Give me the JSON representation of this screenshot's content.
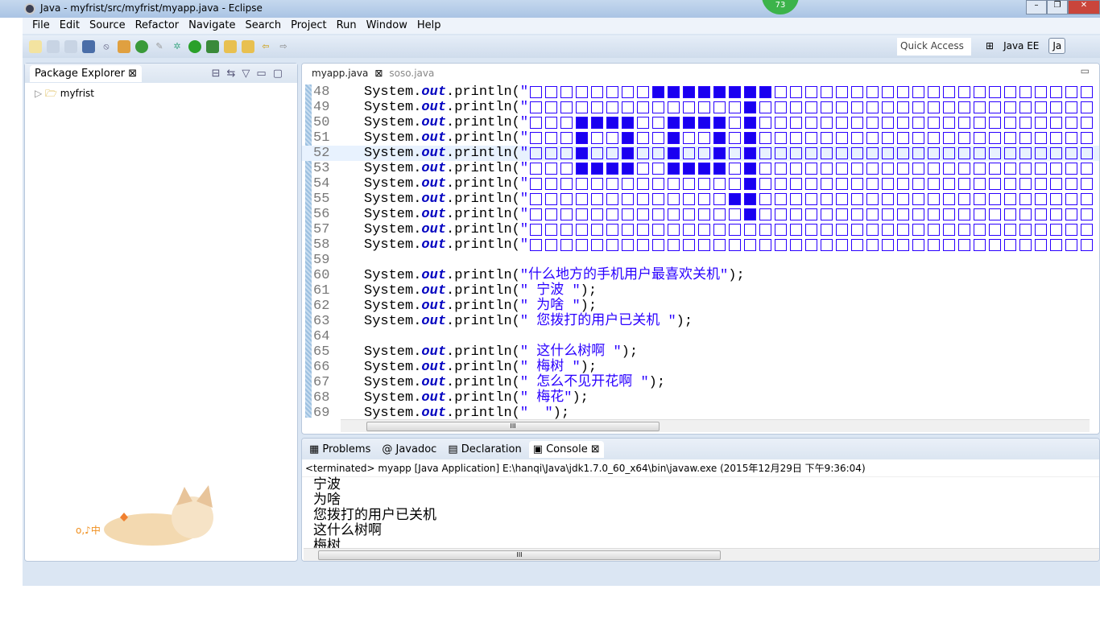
{
  "window": {
    "title": "Java - myfrist/src/myfrist/myapp.java - Eclipse",
    "badge": "73",
    "min": "–",
    "max": "❐",
    "close": "✕"
  },
  "menu": [
    "File",
    "Edit",
    "Source",
    "Refactor",
    "Navigate",
    "Search",
    "Project",
    "Run",
    "Window",
    "Help"
  ],
  "toolbar": {
    "quick_access": "Quick Access",
    "perspectives": [
      "Java EE",
      "Ja"
    ]
  },
  "package_explorer": {
    "title": "Package Explorer",
    "tree": [
      {
        "label": "myfrist",
        "expanded": false
      }
    ],
    "decoration_text": "o,♪中"
  },
  "editor": {
    "tabs": [
      {
        "label": "myapp.java",
        "active": true
      },
      {
        "label": "soso.java",
        "active": false
      }
    ],
    "current_line": 52,
    "lines": [
      {
        "n": "48",
        "type": "pattern",
        "pattern": "□□□□□□□□■■■■■■■■□□□□□□□□□□□□□□□□□□□□□"
      },
      {
        "n": "49",
        "type": "pattern",
        "pattern": "□□□□□□□□□□□□□□■□□□□□□□□□□□□□□□□□□□□□□"
      },
      {
        "n": "50",
        "type": "pattern",
        "pattern": "□□□■■■■□□■■■■□■□□□□□□□□□□□□□□□□□□□□□□"
      },
      {
        "n": "51",
        "type": "pattern",
        "pattern": "□□□■□□■□□■□□■□■□□□□□□□□□□□□□□□□□□□□□□"
      },
      {
        "n": "52",
        "type": "pattern",
        "pattern": "□□□■□□■□□■□□■□■□□□□□□□□□□□□□□□□□□□□□□"
      },
      {
        "n": "53",
        "type": "pattern",
        "pattern": "□□□■■■■□□■■■■□■□□□□□□□□□□□□□□□□□□□□□□"
      },
      {
        "n": "54",
        "type": "pattern",
        "pattern": "□□□□□□□□□□□□□□■□□□□□□□□□□□□□□□□□□□□□□"
      },
      {
        "n": "55",
        "type": "pattern",
        "pattern": "□□□□□□□□□□□□□■■□□□□□□□□□□□□□□□□□□□□□□"
      },
      {
        "n": "56",
        "type": "pattern",
        "pattern": "□□□□□□□□□□□□□□■□□□□□□□□□□□□□□□□□□□□□□"
      },
      {
        "n": "57",
        "type": "pattern",
        "pattern": "□□□□□□□□□□□□□□□□□□□□□□□□□□□□□□□□□□□□□"
      },
      {
        "n": "58",
        "type": "pattern",
        "pattern": "□□□□□□□□□□□□□□□□□□□□□□□□□□□□□□□□□□□□□"
      },
      {
        "n": "59",
        "type": "blank"
      },
      {
        "n": "60",
        "type": "print",
        "str": "\"什么地方的手机用户最喜欢关机\"",
        "end": ");"
      },
      {
        "n": "61",
        "type": "print",
        "str": "\" 宁波 \"",
        "end": ");"
      },
      {
        "n": "62",
        "type": "print",
        "str": "\" 为啥 \"",
        "end": ");"
      },
      {
        "n": "63",
        "type": "print",
        "str": "\" 您拨打的用户已关机 \"",
        "end": ");"
      },
      {
        "n": "64",
        "type": "blank"
      },
      {
        "n": "65",
        "type": "print",
        "str": "\" 这什么树啊 \"",
        "end": ");"
      },
      {
        "n": "66",
        "type": "print",
        "str": "\" 梅树 \"",
        "end": ");"
      },
      {
        "n": "67",
        "type": "print",
        "str": "\" 怎么不见开花啊 \"",
        "end": ");"
      },
      {
        "n": "68",
        "type": "print",
        "str": "\" 梅花\"",
        "end": ");"
      },
      {
        "n": "69",
        "type": "print",
        "str": "\"  \"",
        "end": ");"
      }
    ],
    "code_prefix": "System.",
    "code_field": "out",
    "code_method": ".println("
  },
  "console": {
    "tabs": [
      {
        "label": "Problems"
      },
      {
        "label": "Javadoc"
      },
      {
        "label": "Declaration"
      },
      {
        "label": "Console",
        "active": true
      }
    ],
    "info": "<terminated> myapp [Java Application] E:\\hanqi\\Java\\jdk1.7.0_60_x64\\bin\\javaw.exe (2015年12月29日 下午9:36:04)",
    "output": [
      "宁波",
      "为啥",
      "您拨打的用户已关机",
      "这什么树啊",
      "梅树"
    ]
  },
  "colors": {
    "keyword": "#0000c0",
    "string": "#2a00ff",
    "filled_square": "#1a00f0"
  }
}
